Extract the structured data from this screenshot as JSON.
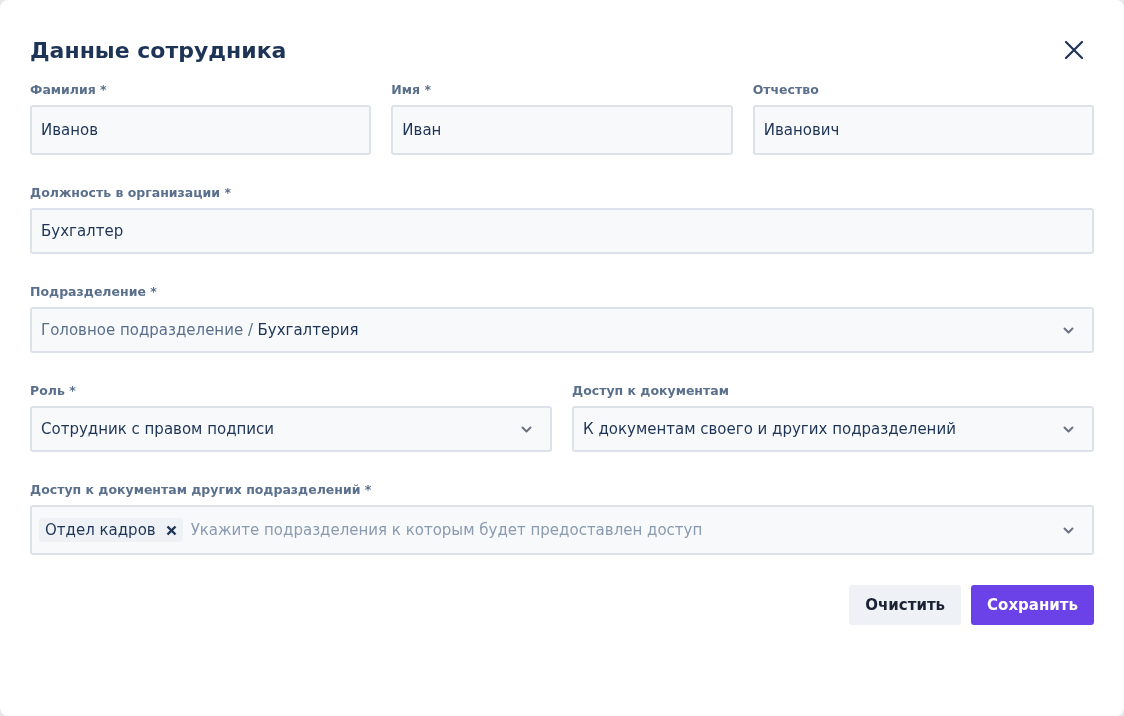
{
  "dialog": {
    "title": "Данные сотрудника"
  },
  "rows": [
    {
      "fields": [
        {
          "kind": "text",
          "label": "Фамилия *",
          "value": "Иванов"
        },
        {
          "kind": "text",
          "label": "Имя *",
          "value": "Иван"
        },
        {
          "kind": "text",
          "label": "Отчество",
          "value": "Иванович"
        }
      ]
    },
    {
      "fields": [
        {
          "kind": "text",
          "label": "Должность в организации *",
          "value": "Бухгалтер"
        }
      ]
    },
    {
      "fields": [
        {
          "kind": "select",
          "label": "Подразделение *",
          "parent": "Головное подразделение /",
          "value": "Бухгалтерия"
        }
      ]
    },
    {
      "fields": [
        {
          "kind": "select",
          "label": "Роль *",
          "value": "Сотрудник с правом подписи"
        },
        {
          "kind": "select",
          "label": "Доступ к документам",
          "value": "К документам своего и других подразделений"
        }
      ]
    },
    {
      "fields": [
        {
          "kind": "tags",
          "label": "Доступ к документам других подразделений *",
          "tags": [
            "Отдел кадров"
          ],
          "placeholder": "Укажите подразделения к которым будет предоставлен доступ"
        }
      ]
    }
  ],
  "buttons": [
    {
      "kind": "secondary",
      "label": "Очистить"
    },
    {
      "kind": "primary",
      "label": "Сохранить"
    }
  ]
}
